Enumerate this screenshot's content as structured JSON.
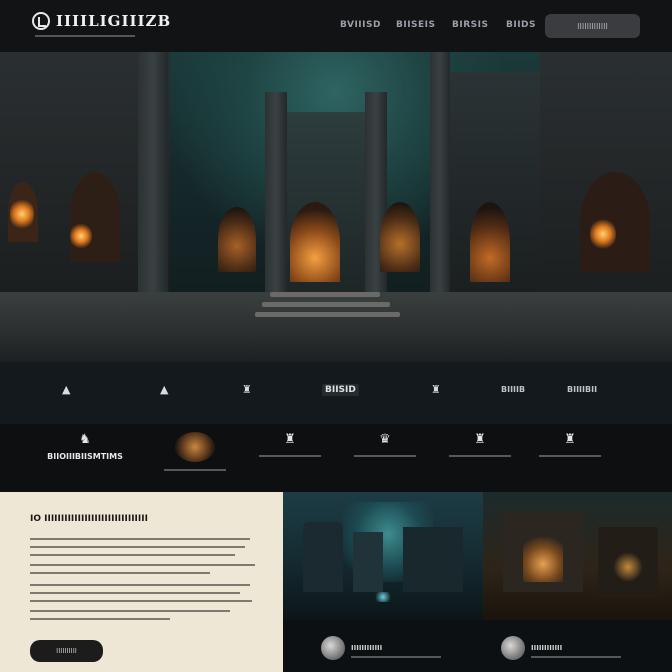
{
  "header": {
    "logo_text": "IIIILIGIIIZB",
    "nav": [
      "BVIIISD",
      "BIISEIS",
      "BIRSIS",
      "BIIDS"
    ],
    "cta_label": "IIIIIIIIIIIII"
  },
  "features": [
    {
      "icon": "▲",
      "label": ""
    },
    {
      "icon": "▲",
      "label": ""
    },
    {
      "icon": "♜",
      "label": ""
    },
    {
      "icon": "",
      "label": "BIISID"
    },
    {
      "icon": "♜",
      "label": ""
    },
    {
      "icon": "",
      "label": "BIIIIB"
    },
    {
      "icon": "",
      "label": "BIIIIBII"
    }
  ],
  "cards": [
    {
      "icon": "♞",
      "title": "BIIOIIIBIISMTIMS"
    },
    {
      "icon": "",
      "title": ""
    },
    {
      "icon": "♜",
      "title": ""
    },
    {
      "icon": "♛",
      "title": ""
    },
    {
      "icon": "♜",
      "title": ""
    },
    {
      "icon": "♜",
      "title": ""
    }
  ],
  "about": {
    "title": "IO IIIIIIIIIIIIIIIIIIIIIIIIIIIIIII",
    "button_label": "IIIIIIIIII"
  },
  "testimonials": [
    {
      "name": "IIIIIIIIIIII"
    },
    {
      "name": "IIIIIIIIIIII"
    }
  ]
}
